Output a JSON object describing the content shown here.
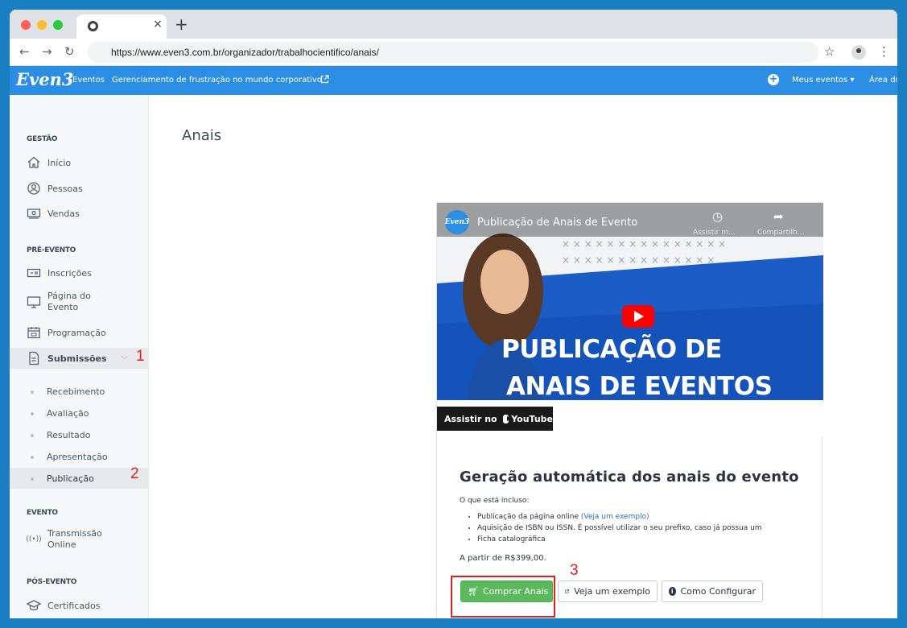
{
  "browser": {
    "tab_close": "×",
    "new_tab": "+",
    "url": "https://www.even3.com.br/organizador/trabalhocientifico/anais/"
  },
  "appbar": {
    "logo": "Even3",
    "eventos": "Eventos",
    "event_name": "Gerenciamento de frustração no mundo corporativo",
    "meus_eventos": "Meus eventos ▾",
    "area": "Área do"
  },
  "sidebar": {
    "gestao_label": "GESTÃO",
    "gestao": [
      "Início",
      "Pessoas",
      "Vendas"
    ],
    "pre_label": "PRÉ-EVENTO",
    "pre_inscricoes": "Inscrições",
    "pre_pagina_1": "Página do",
    "pre_pagina_2": "Evento",
    "pre_programacao": "Programação",
    "submissoes": "Submissões",
    "sub_items": [
      "Recebimento",
      "Avaliação",
      "Resultado",
      "Apresentação",
      "Publicação"
    ],
    "evento_label": "EVENTO",
    "transmissao_1": "Transmissão",
    "transmissao_2": "Online",
    "pos_label": "PÓS-EVENTO",
    "certificados": "Certificados"
  },
  "annotations": [
    "1",
    "2",
    "3"
  ],
  "main": {
    "page_title": "Anais"
  },
  "video": {
    "channel_badge": "Even3",
    "title": "Publicação de Anais de Evento",
    "watch_later": "Assistir m...",
    "share": "Compartilh...",
    "headline_1": "PUBLICAÇÃO DE",
    "headline_2": "ANAIS DE EVENTOS",
    "watch_on": "Assistir no",
    "youtube": "YouTube"
  },
  "card": {
    "title": "Geração automática dos anais do evento",
    "included_label": "O que está incluso:",
    "item1_text": "Publicação da página online ",
    "item1_link": "(Veja um exemplo)",
    "item2": "Aquisição de ISBN ou ISSN. É possível utilizar o seu prefixo, caso já possua um",
    "item3": "Ficha catalográfica",
    "price": "A partir de R$399,00.",
    "btn_buy": "Comprar Anais",
    "btn_example": "Veja um exemplo",
    "btn_config": "Como Configurar"
  },
  "colors": {
    "appbar": "#2b8ee3",
    "buy_button": "#5cb85c",
    "annotation": "#e02020",
    "page_bg": "#1a7ec2"
  }
}
